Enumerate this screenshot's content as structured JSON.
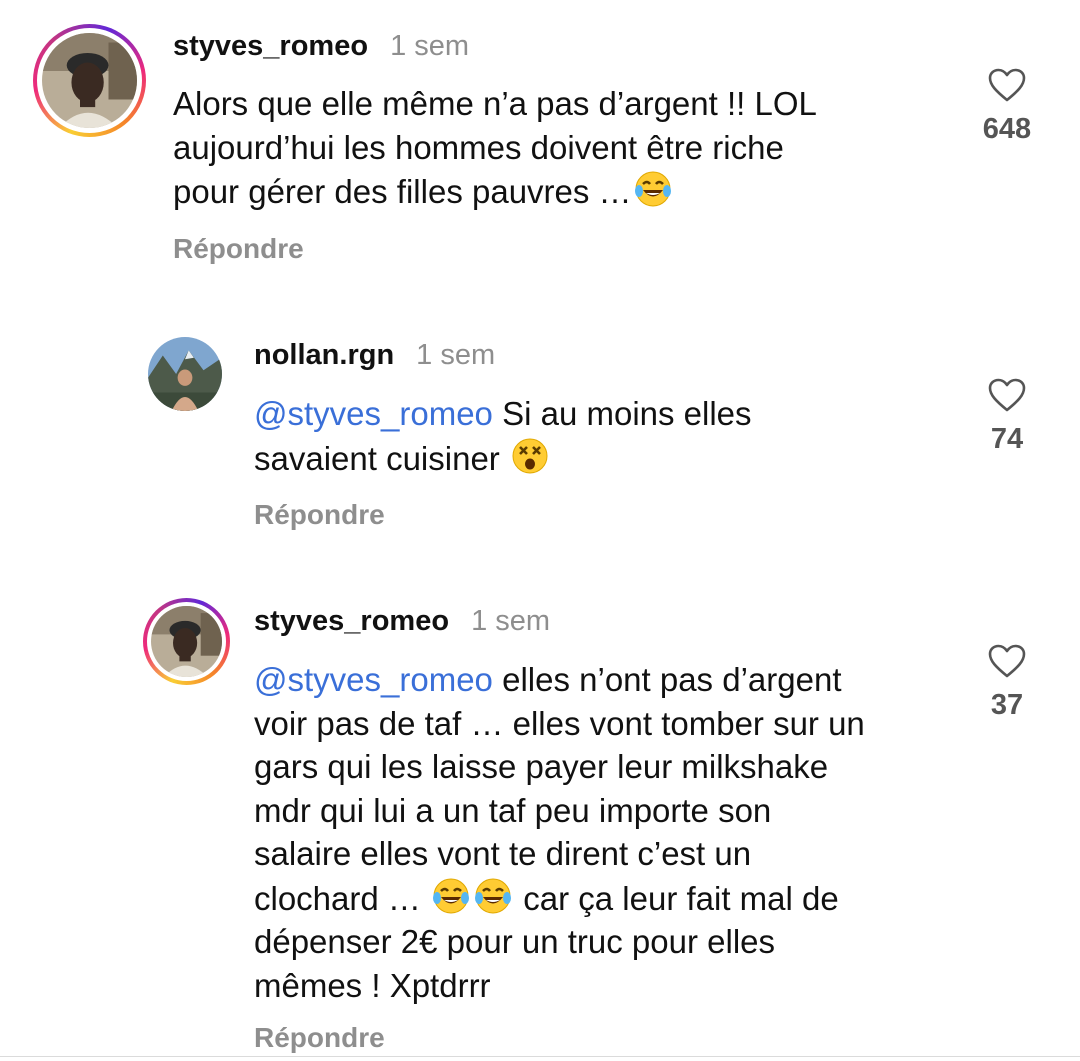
{
  "comments": [
    {
      "username": "styves_romeo",
      "time": "1 sem",
      "mention": "",
      "text_before": "Alors que elle même n’a pas d’argent !! LOL\naujourd’hui les hommes doivent être riche\npour gérer des filles pauvres …",
      "emojis": [
        "laughing-tears-emoji"
      ],
      "text_after": "",
      "likes": "648",
      "reply_label": "Répondre",
      "avatar": "user-photo-dark-cap"
    },
    {
      "username": "nollan.rgn",
      "time": "1 sem",
      "mention": "@styves_romeo",
      "text_before": " Si au moins elles\nsavaient cuisiner ",
      "emojis": [
        "dizzy-face-emoji"
      ],
      "text_after": "",
      "likes": "74",
      "reply_label": "Répondre",
      "avatar": "user-photo-mountains"
    },
    {
      "username": "styves_romeo",
      "time": "1 sem",
      "mention": "@styves_romeo",
      "text_before": " elles n’ont pas d’argent\nvoir pas de taf … elles vont tomber sur un\ngars qui les laisse payer leur milkshake\nmdr qui lui a un taf peu importe son\nsalaire elles vont te dirent c’est un\nclochard … ",
      "emojis": [
        "laughing-tears-emoji",
        "laughing-tears-emoji"
      ],
      "text_after": " car ça leur fait mal de\ndépenser 2€ pour un truc pour elles\nmêmes ! Xptdrrr",
      "likes": "37",
      "reply_label": "Répondre",
      "avatar": "user-photo-dark-cap"
    }
  ],
  "colors": {
    "mention": "#3a6fd8",
    "secondary_text": "#8e8e8e",
    "story_ring": "#ee2a7b"
  },
  "icons": {
    "like": "heart-outline-icon"
  }
}
